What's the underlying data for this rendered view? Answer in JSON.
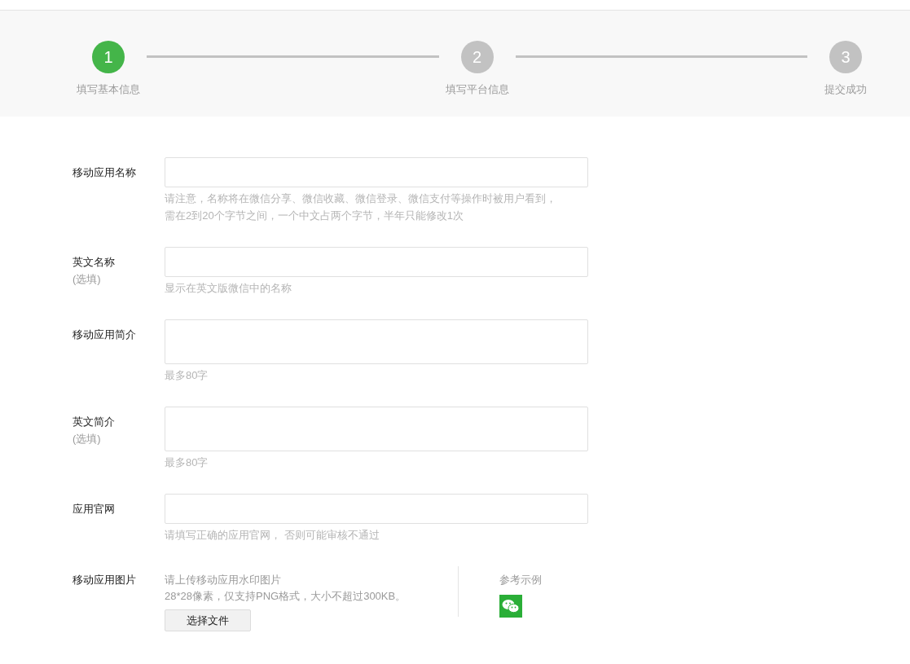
{
  "steps": [
    {
      "number": "1",
      "label": "填写基本信息",
      "selected": true
    },
    {
      "number": "2",
      "label": "填写平台信息",
      "selected": false
    },
    {
      "number": "3",
      "label": "提交成功",
      "selected": false
    }
  ],
  "fields": [
    {
      "kind": "input",
      "label": "移动应用名称",
      "hints": [
        "请注意，名称将在微信分享、微信收藏、微信登录、微信支付等操作时被用户看到，",
        "需在2到20个字节之间，一个中文占两个字节，半年只能修改1次"
      ]
    },
    {
      "kind": "input",
      "label": "英文名称",
      "optional": "(选填)",
      "hints": [
        "显示在英文版微信中的名称"
      ]
    },
    {
      "kind": "textarea",
      "label": "移动应用简介",
      "hints": [
        "最多80字"
      ]
    },
    {
      "kind": "textarea",
      "label": "英文简介",
      "optional": "(选填)",
      "hints": [
        "最多80字"
      ]
    },
    {
      "kind": "input",
      "label": "应用官网",
      "hints": [
        "请填写正确的应用官网， 否则可能审核不通过"
      ]
    }
  ],
  "upload": {
    "label": "移动应用图片",
    "hints": [
      "请上传移动应用水印图片",
      "28*28像素，仅支持PNG格式，大小不超过300KB。"
    ],
    "button": "选择文件",
    "example_label": "参考示例"
  }
}
